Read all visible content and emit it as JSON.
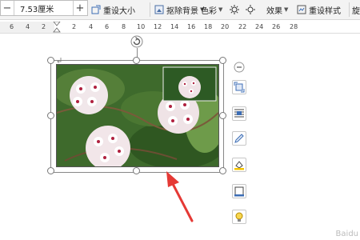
{
  "toolbar": {
    "minus_label": "−",
    "plus_label": "+",
    "width_value": "7.53厘米",
    "reset_size_label": "重设大小",
    "remove_bg_label": "抠除背景",
    "color_label": "色彩",
    "effects_label": "效果",
    "reset_style_label": "重设样式",
    "rotate_label": "旋"
  },
  "ruler": {
    "numbers": [
      "6",
      "4",
      "2",
      "2",
      "4",
      "6",
      "8",
      "10",
      "12",
      "14",
      "16",
      "18",
      "20",
      "22",
      "24",
      "26",
      "28"
    ]
  },
  "icons": {
    "collapse": "minus-icon",
    "tools": [
      "layout-options-icon",
      "wrap-text-icon",
      "edit-pen-icon",
      "fill-color-icon",
      "border-icon",
      "tips-bulb-icon"
    ]
  },
  "colors": {
    "accent": "#e53935",
    "selection": "#888888",
    "toolbar_bg": "#f3f3f3"
  },
  "watermark": "Baidu"
}
